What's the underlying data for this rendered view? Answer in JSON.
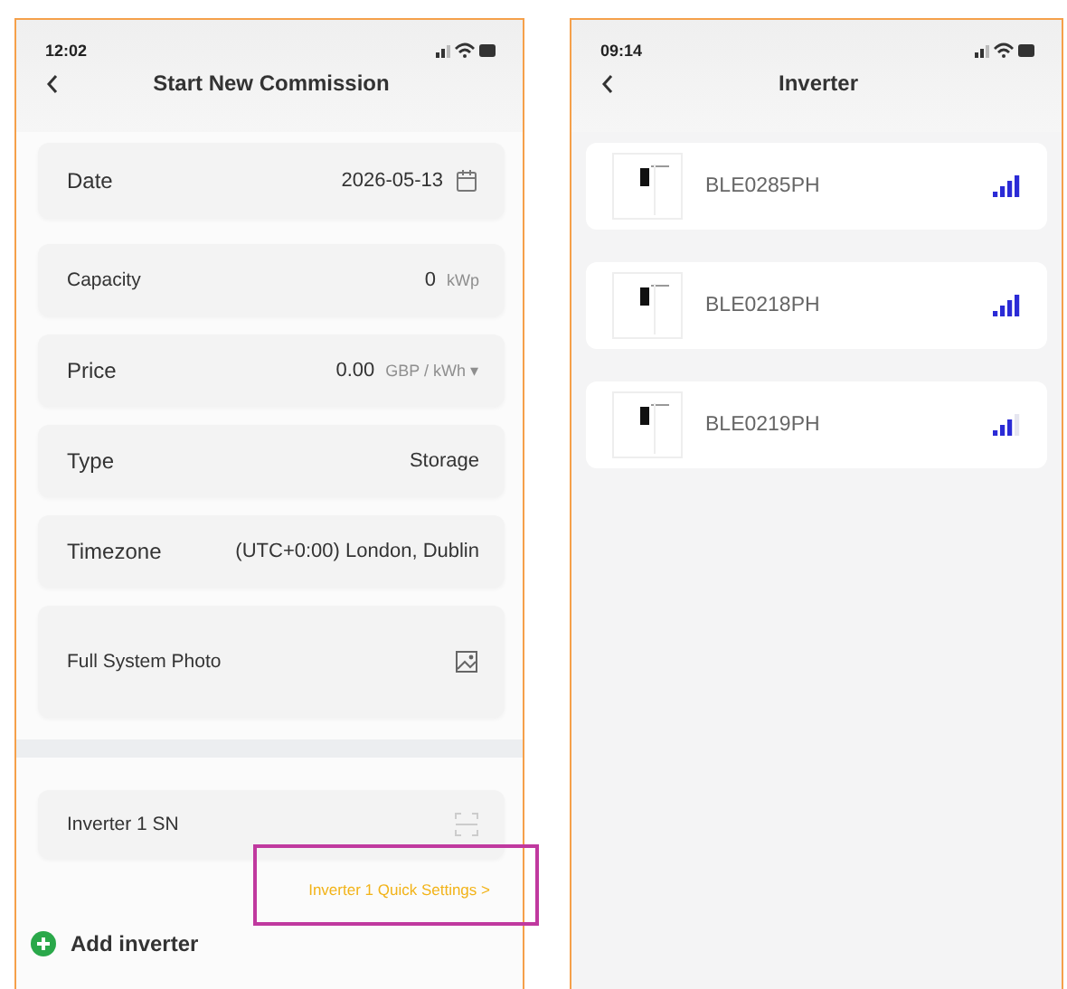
{
  "left_screen": {
    "status_time": "12:02",
    "title": "Start New Commission",
    "fields": [
      {
        "kind": "date",
        "label": "Date",
        "value": "2026-05-13"
      },
      {
        "kind": "unit",
        "label": "Capacity",
        "value": "0",
        "unit": "kWp"
      },
      {
        "kind": "unit",
        "label": "Price",
        "value": "0.00",
        "unit": "GBP / kWh ▾"
      },
      {
        "kind": "plain",
        "label": "Type",
        "value": "Storage"
      },
      {
        "kind": "plain",
        "label": "Timezone",
        "value": "(UTC+0:00) London, Dublin"
      },
      {
        "kind": "photo",
        "label": "Full System Photo"
      }
    ],
    "inverter_sn": {
      "label": "Inverter 1 SN"
    },
    "quick_settings_link": "Inverter 1 Quick Settings >",
    "add_inverter": "Add inverter"
  },
  "right_screen": {
    "status_time": "09:14",
    "title": "Inverter",
    "devices": [
      {
        "name": "BLE0285PH",
        "kind": "strong"
      },
      {
        "name": "BLE0218PH",
        "kind": "strong"
      },
      {
        "name": "BLE0219PH",
        "kind": "medium"
      }
    ]
  }
}
